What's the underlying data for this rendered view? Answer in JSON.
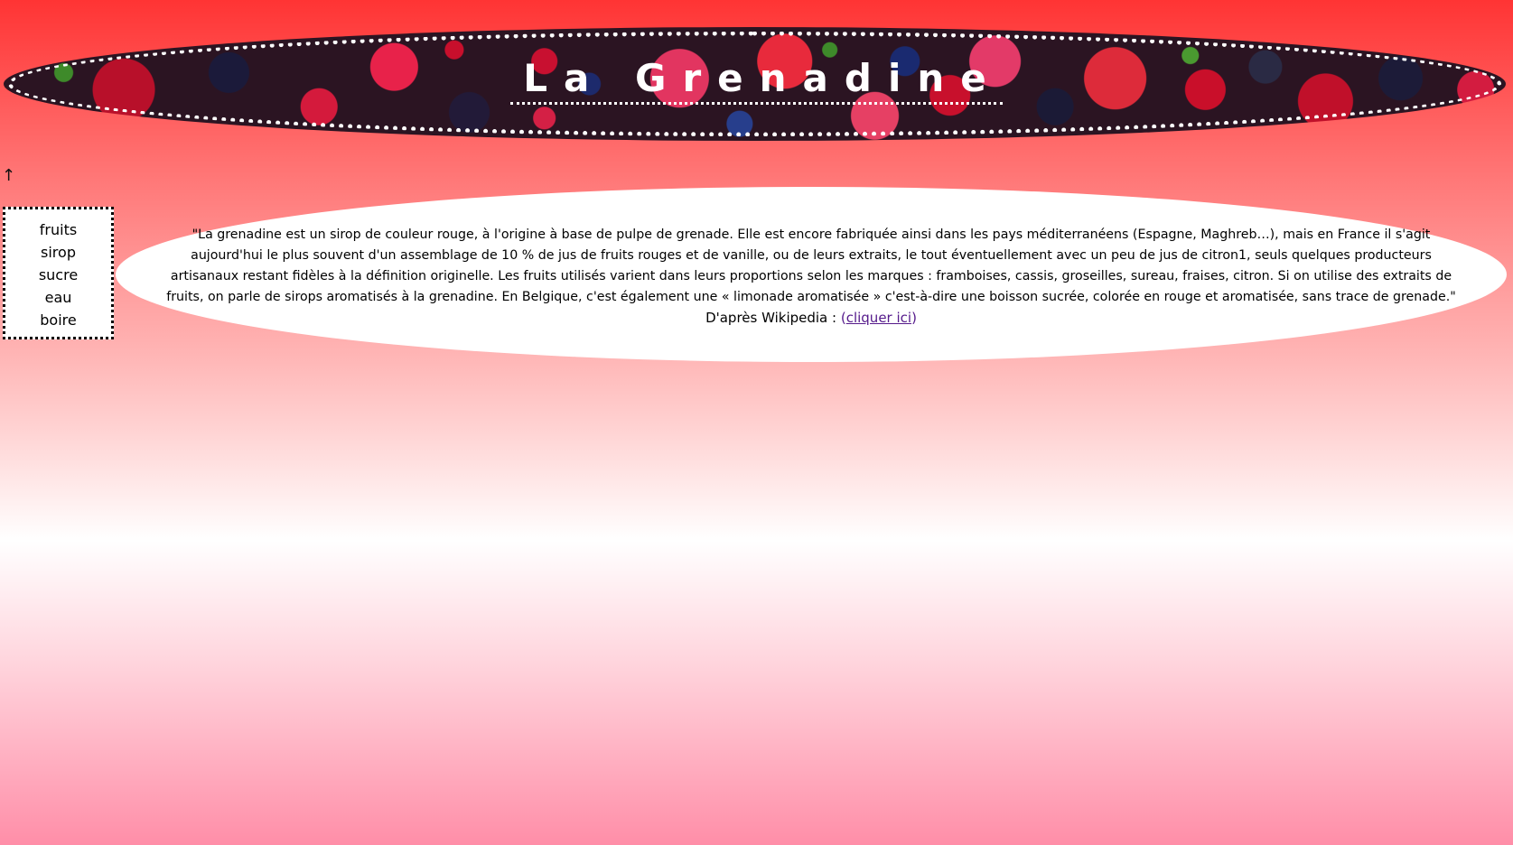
{
  "header": {
    "title": "La Grenadine"
  },
  "nav": {
    "up_arrow": "↑",
    "items": [
      {
        "label": "fruits"
      },
      {
        "label": "sirop"
      },
      {
        "label": "sucre"
      },
      {
        "label": "eau"
      },
      {
        "label": "boire"
      }
    ]
  },
  "content": {
    "quote": "\"La grenadine est un sirop de couleur rouge, à l'origine à base de pulpe de grenade. Elle est encore fabriquée ainsi dans les pays méditerranéens (Espagne, Maghreb…), mais en France il s'agit aujourd'hui le plus souvent d'un assemblage de 10 % de jus de fruits rouges et de vanille, ou de leurs extraits, le tout éventuellement avec un peu de jus de citron1, seuls quelques producteurs artisanaux restant fidèles à la définition originelle. Les fruits utilisés varient dans leurs proportions selon les marques : framboises, cassis, groseilles, sureau, fraises, citron. Si on utilise des extraits de fruits, on parle de sirops aromatisés à la grenadine. En Belgique, c'est également une « limonade aromatisée » c'est-à-dire une boisson sucrée, colorée en rouge et aromatisée, sans trace de grenade.\"",
    "source_prefix": "D'après Wikipedia : ",
    "paren_open": "(",
    "link_label": "cliquer ici",
    "paren_close": ")"
  }
}
